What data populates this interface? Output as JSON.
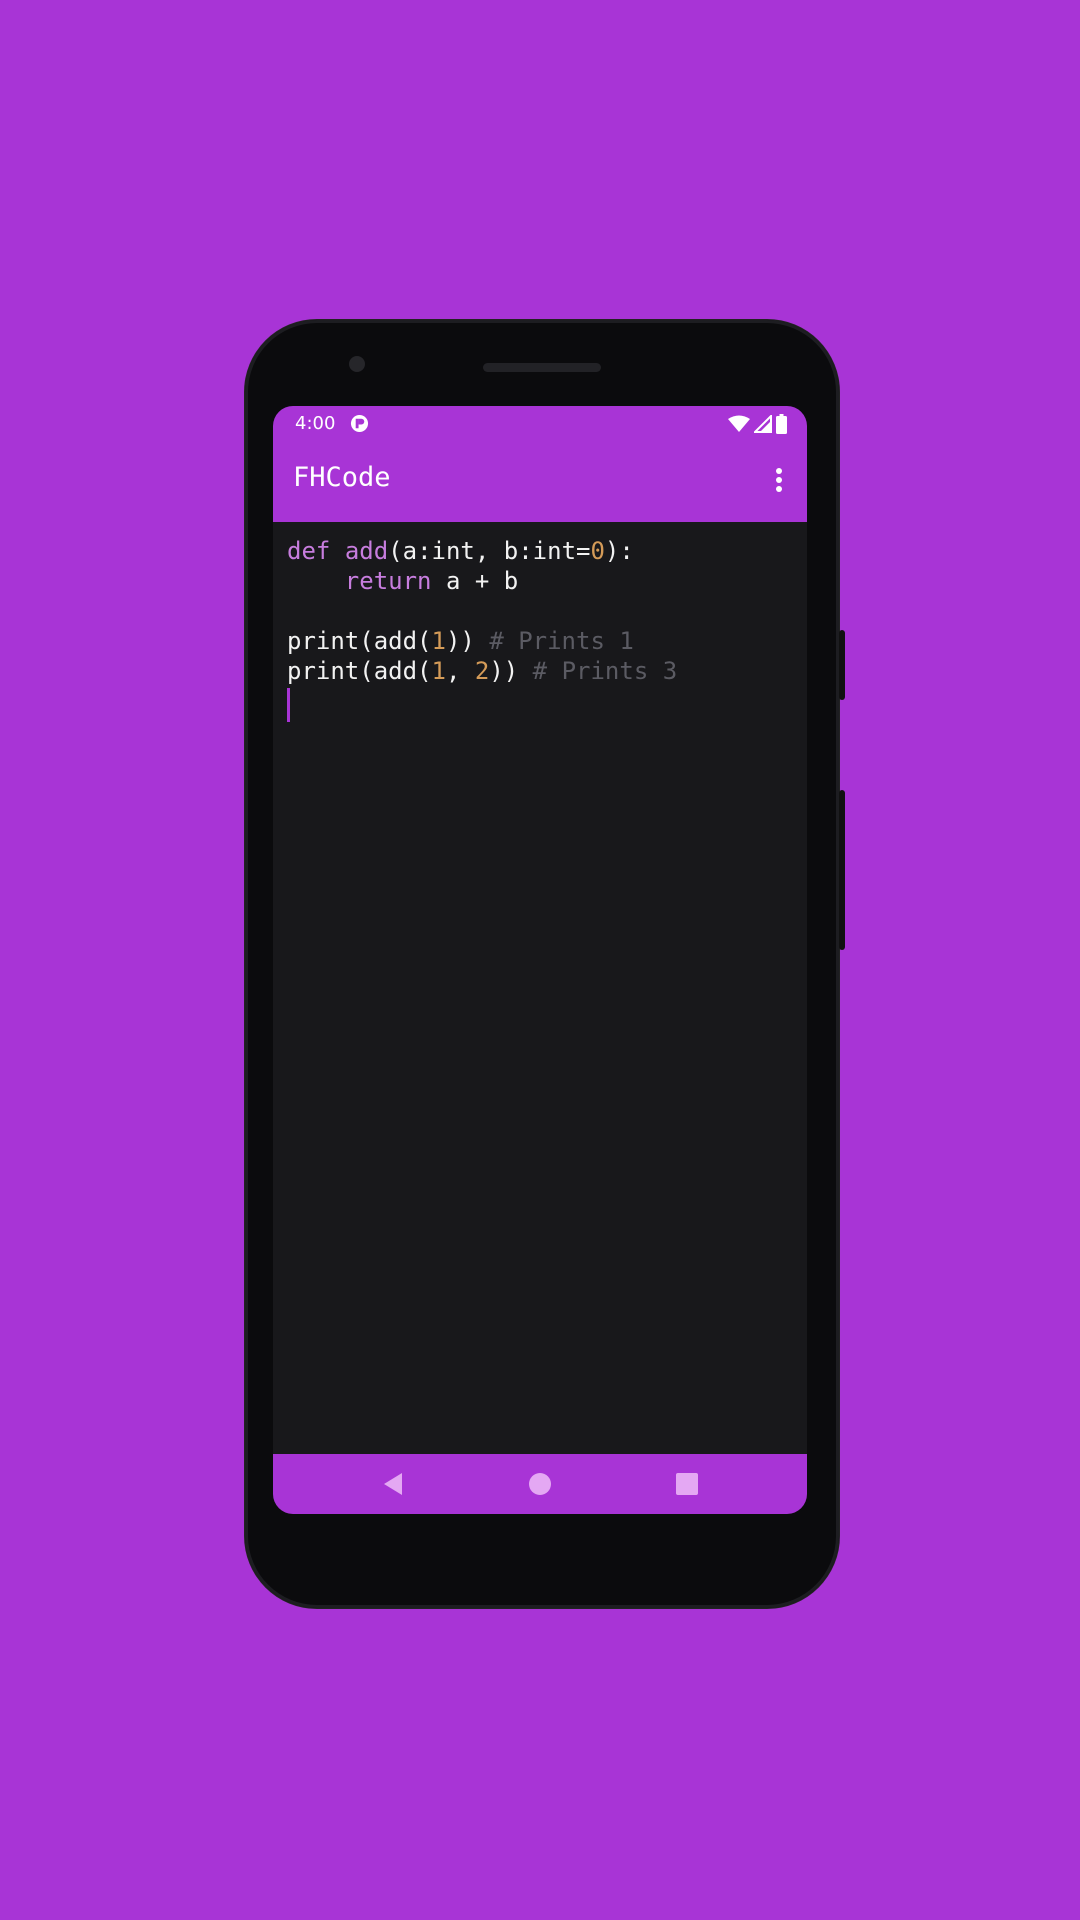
{
  "status_bar": {
    "time": "4:00",
    "icons": [
      "app-notification-icon",
      "wifi-icon",
      "cell-signal-icon",
      "battery-icon"
    ]
  },
  "app_bar": {
    "title": "FHCode",
    "menu_icon": "overflow-menu-icon"
  },
  "editor": {
    "lines": [
      [
        {
          "text": "def",
          "kind": "keyword"
        },
        {
          "text": " ",
          "kind": "plain"
        },
        {
          "text": "add",
          "kind": "function"
        },
        {
          "text": "(a:int, b:int=",
          "kind": "plain"
        },
        {
          "text": "0",
          "kind": "number"
        },
        {
          "text": "):",
          "kind": "plain"
        }
      ],
      [
        {
          "text": "    ",
          "kind": "plain"
        },
        {
          "text": "return",
          "kind": "keyword"
        },
        {
          "text": " a + b",
          "kind": "plain"
        }
      ],
      [],
      [
        {
          "text": "print(add(",
          "kind": "plain"
        },
        {
          "text": "1",
          "kind": "number"
        },
        {
          "text": ")) ",
          "kind": "plain"
        },
        {
          "text": "# Prints 1",
          "kind": "comment"
        }
      ],
      [
        {
          "text": "print(add(",
          "kind": "plain"
        },
        {
          "text": "1",
          "kind": "number"
        },
        {
          "text": ", ",
          "kind": "plain"
        },
        {
          "text": "2",
          "kind": "number"
        },
        {
          "text": ")) ",
          "kind": "plain"
        },
        {
          "text": "# Prints 3",
          "kind": "comment"
        }
      ]
    ]
  },
  "nav_bar": {
    "buttons": [
      "back-icon",
      "home-icon",
      "recents-icon"
    ]
  },
  "colors": {
    "accent": "#a834d6",
    "editor_background": "#18181b",
    "keyword": "#c77dde",
    "number": "#d49b58",
    "comment": "#5b5b63",
    "text": "#f2f2f2"
  }
}
